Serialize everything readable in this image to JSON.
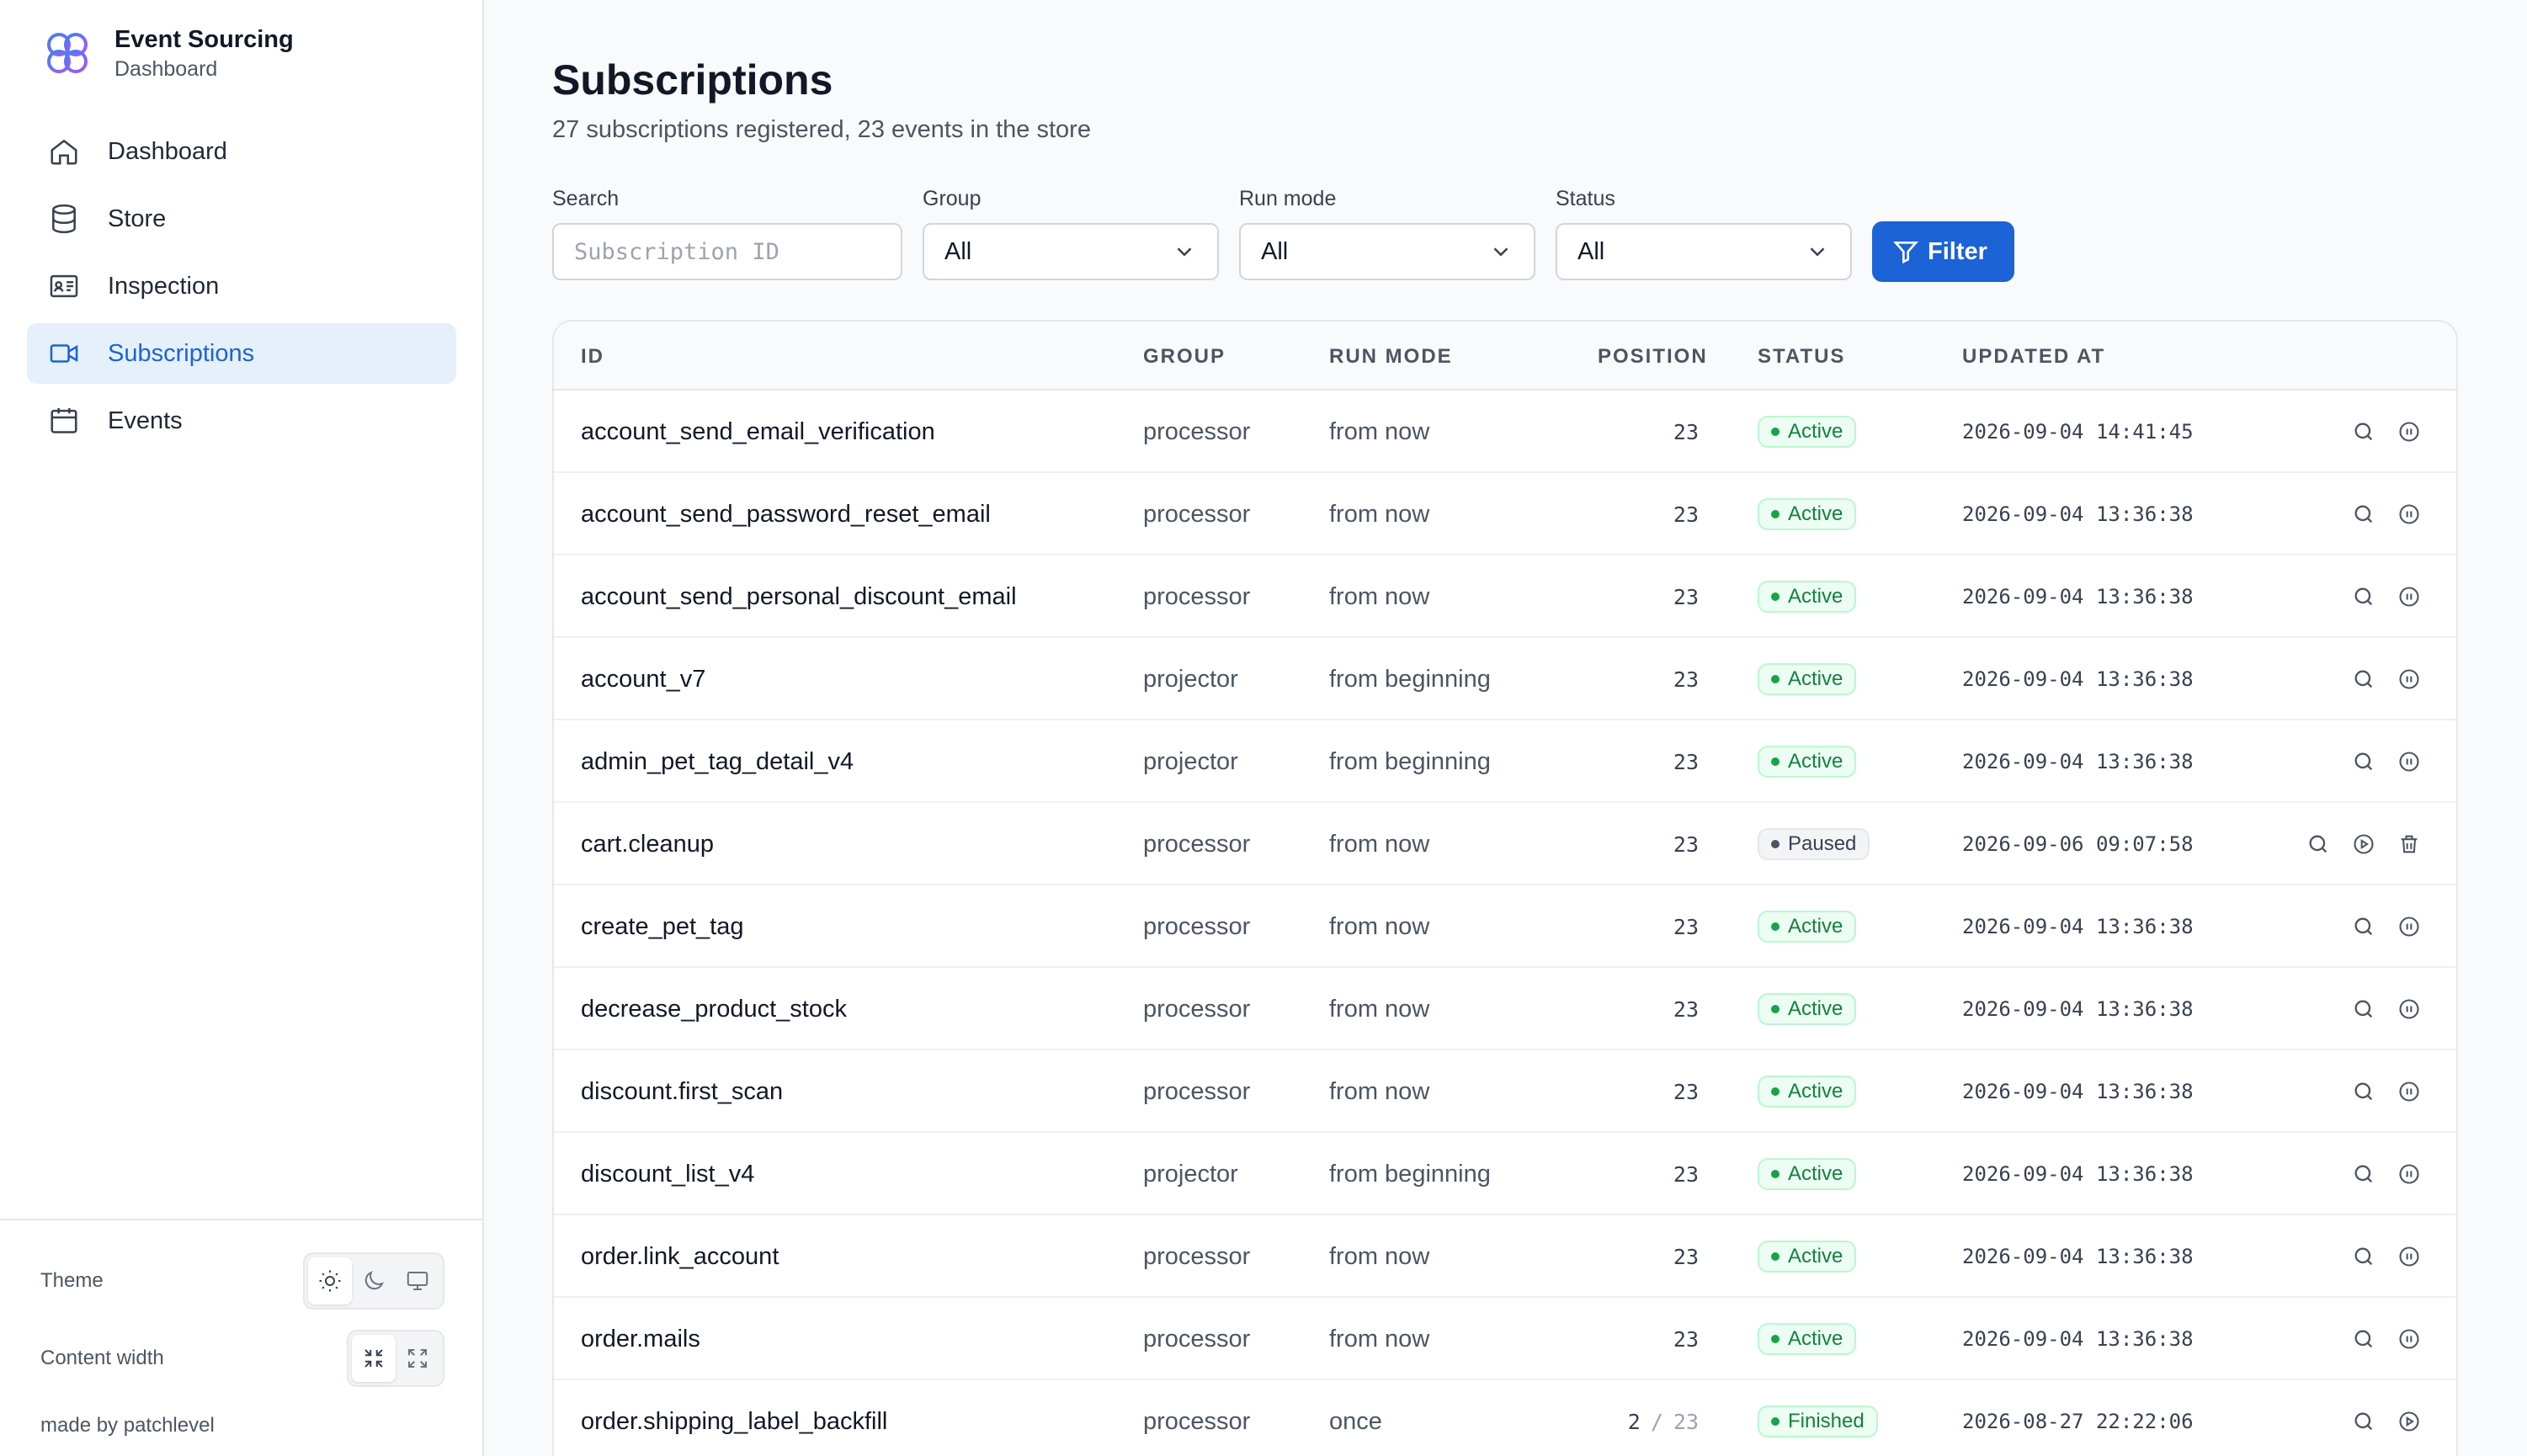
{
  "brand": {
    "title": "Event Sourcing",
    "subtitle": "Dashboard"
  },
  "nav": [
    {
      "label": "Dashboard",
      "icon": "home-icon",
      "active": false
    },
    {
      "label": "Store",
      "icon": "database-icon",
      "active": false
    },
    {
      "label": "Inspection",
      "icon": "id-card-icon",
      "active": false
    },
    {
      "label": "Subscriptions",
      "icon": "video-icon",
      "active": true
    },
    {
      "label": "Events",
      "icon": "calendar-icon",
      "active": false
    }
  ],
  "footer": {
    "theme_label": "Theme",
    "content_width_label": "Content width",
    "made_by": "made by patchlevel"
  },
  "page": {
    "title": "Subscriptions",
    "subtitle": "27 subscriptions registered, 23 events in the store"
  },
  "filters": {
    "search_label": "Search",
    "search_placeholder": "Subscription ID",
    "group_label": "Group",
    "group_value": "All",
    "run_mode_label": "Run mode",
    "run_mode_value": "All",
    "status_label": "Status",
    "status_value": "All",
    "filter_button": "Filter"
  },
  "table": {
    "headers": {
      "id": "ID",
      "group": "GROUP",
      "run_mode": "RUN MODE",
      "position": "POSITION",
      "status": "STATUS",
      "updated_at": "UPDATED AT"
    },
    "rows": [
      {
        "id": "account_send_email_verification",
        "group": "processor",
        "run_mode": "from now",
        "position": "23",
        "status": "Active",
        "updated_at": "2026-09-04 14:41:45"
      },
      {
        "id": "account_send_password_reset_email",
        "group": "processor",
        "run_mode": "from now",
        "position": "23",
        "status": "Active",
        "updated_at": "2026-09-04 13:36:38"
      },
      {
        "id": "account_send_personal_discount_email",
        "group": "processor",
        "run_mode": "from now",
        "position": "23",
        "status": "Active",
        "updated_at": "2026-09-04 13:36:38"
      },
      {
        "id": "account_v7",
        "group": "projector",
        "run_mode": "from beginning",
        "position": "23",
        "status": "Active",
        "updated_at": "2026-09-04 13:36:38"
      },
      {
        "id": "admin_pet_tag_detail_v4",
        "group": "projector",
        "run_mode": "from beginning",
        "position": "23",
        "status": "Active",
        "updated_at": "2026-09-04 13:36:38"
      },
      {
        "id": "cart.cleanup",
        "group": "processor",
        "run_mode": "from now",
        "position": "23",
        "status": "Paused",
        "updated_at": "2026-09-06 09:07:58"
      },
      {
        "id": "create_pet_tag",
        "group": "processor",
        "run_mode": "from now",
        "position": "23",
        "status": "Active",
        "updated_at": "2026-09-04 13:36:38"
      },
      {
        "id": "decrease_product_stock",
        "group": "processor",
        "run_mode": "from now",
        "position": "23",
        "status": "Active",
        "updated_at": "2026-09-04 13:36:38"
      },
      {
        "id": "discount.first_scan",
        "group": "processor",
        "run_mode": "from now",
        "position": "23",
        "status": "Active",
        "updated_at": "2026-09-04 13:36:38"
      },
      {
        "id": "discount_list_v4",
        "group": "projector",
        "run_mode": "from beginning",
        "position": "23",
        "status": "Active",
        "updated_at": "2026-09-04 13:36:38"
      },
      {
        "id": "order.link_account",
        "group": "processor",
        "run_mode": "from now",
        "position": "23",
        "status": "Active",
        "updated_at": "2026-09-04 13:36:38"
      },
      {
        "id": "order.mails",
        "group": "processor",
        "run_mode": "from now",
        "position": "23",
        "status": "Active",
        "updated_at": "2026-09-04 13:36:38"
      },
      {
        "id": "order.shipping_label_backfill",
        "group": "processor",
        "run_mode": "once",
        "position": "2",
        "position_total": "23",
        "status": "Finished",
        "updated_at": "2026-08-27 22:22:06"
      }
    ]
  },
  "colors": {
    "accent": "#1b63d6",
    "active_bg": "#e6f0fb",
    "status_green": "#15803d"
  }
}
